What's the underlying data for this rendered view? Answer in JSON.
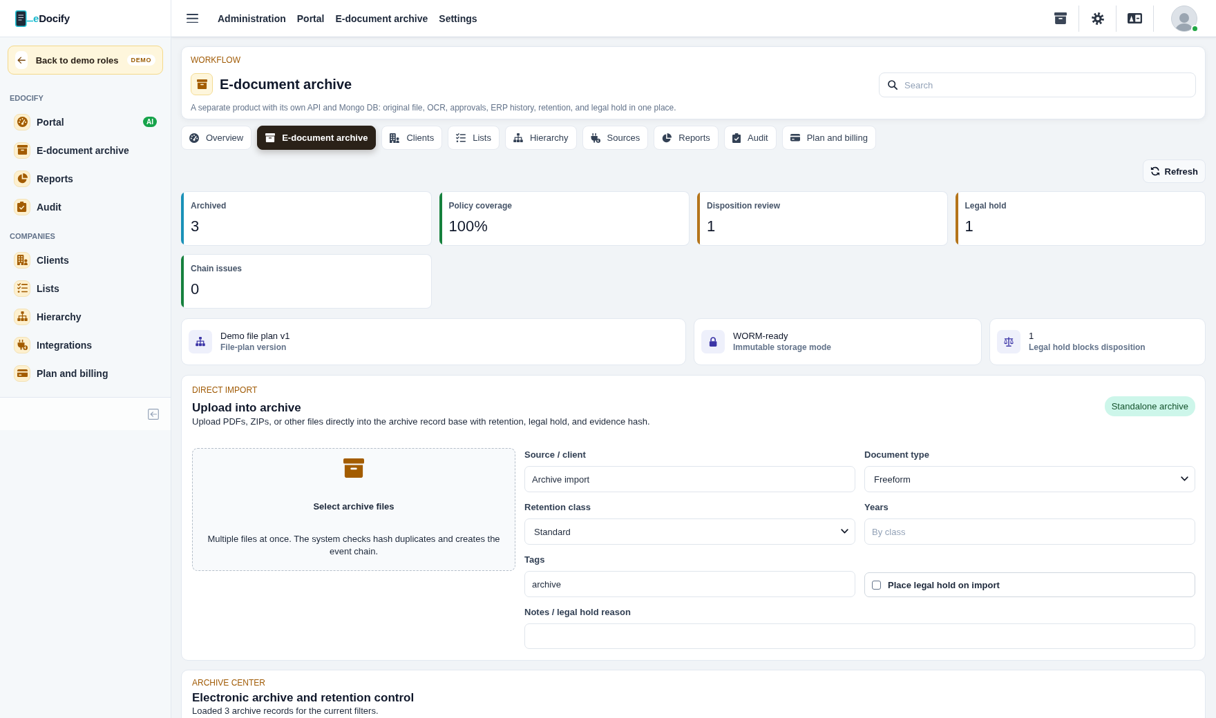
{
  "brand": {
    "accent": "e",
    "name": "Docify"
  },
  "sidebar": {
    "back_button": {
      "label": "Back to demo roles",
      "badge": "DEMO"
    },
    "sections": [
      {
        "title": "EDOCIFY",
        "items": [
          {
            "label": "Portal",
            "badge": "AI"
          },
          {
            "label": "E-document archive"
          },
          {
            "label": "Reports"
          },
          {
            "label": "Audit"
          }
        ]
      },
      {
        "title": "COMPANIES",
        "items": [
          {
            "label": "Clients"
          },
          {
            "label": "Lists"
          },
          {
            "label": "Hierarchy"
          },
          {
            "label": "Integrations"
          },
          {
            "label": "Plan and billing"
          }
        ]
      }
    ]
  },
  "topbar": {
    "links": [
      "Administration",
      "Portal",
      "E-document archive",
      "Settings"
    ],
    "user": {
      "online": true
    }
  },
  "page_header": {
    "eyebrow": "WORKFLOW",
    "title": "E-document archive",
    "description": "A separate product with its own API and Mongo DB: original file, OCR, approvals, ERP history, retention, and legal hold in one place.",
    "search": {
      "placeholder": "Search"
    }
  },
  "tabs": [
    {
      "label": "Overview",
      "selected": false
    },
    {
      "label": "E-document archive",
      "selected": true
    },
    {
      "label": "Clients",
      "selected": false
    },
    {
      "label": "Lists",
      "selected": false
    },
    {
      "label": "Hierarchy",
      "selected": false
    },
    {
      "label": "Sources",
      "selected": false
    },
    {
      "label": "Reports",
      "selected": false
    },
    {
      "label": "Audit",
      "selected": false
    },
    {
      "label": "Plan and billing",
      "selected": false
    }
  ],
  "refresh_button": "Refresh",
  "stats": [
    {
      "label": "Archived",
      "value": "3",
      "color": "#1a91b8"
    },
    {
      "label": "Policy coverage",
      "value": "100%",
      "color": "#16813d"
    },
    {
      "label": "Disposition review",
      "value": "1",
      "color": "#b4741a"
    },
    {
      "label": "Legal hold",
      "value": "1",
      "color": "#b4741a"
    },
    {
      "label": "Chain issues",
      "value": "0",
      "color": "#16813d"
    }
  ],
  "info_cards": [
    {
      "title": "Demo file plan v1",
      "subtitle": "File-plan version"
    },
    {
      "title": "WORM-ready",
      "subtitle": "Immutable storage mode"
    },
    {
      "title": "1",
      "subtitle": "Legal hold blocks disposition"
    }
  ],
  "upload": {
    "eyebrow": "DIRECT IMPORT",
    "title": "Upload into archive",
    "description": "Upload PDFs, ZIPs, or other files directly into the archive record base with retention, legal hold, and evidence hash.",
    "badge": "Standalone archive",
    "dropzone": {
      "title": "Select archive files",
      "description": "Multiple files at once. The system checks hash duplicates and creates the event chain."
    },
    "fields": [
      {
        "kind": "text",
        "label": "Source / client",
        "value": "Archive import"
      },
      {
        "kind": "select",
        "label": "Document type",
        "value": "Freeform"
      },
      {
        "kind": "select",
        "label": "Retention class",
        "value": "Standard"
      },
      {
        "kind": "text",
        "label": "Years",
        "placeholder": "By class"
      },
      {
        "kind": "text",
        "label": "Tags",
        "value": "archive"
      },
      {
        "kind": "checkbox",
        "label": "Place legal hold on import",
        "checked": false
      },
      {
        "kind": "textarea",
        "label": "Notes / legal hold reason"
      }
    ]
  },
  "archive_center": {
    "eyebrow": "ARCHIVE CENTER",
    "title": "Electronic archive and retention control",
    "description": "Loaded 3 archive records for the current filters."
  }
}
